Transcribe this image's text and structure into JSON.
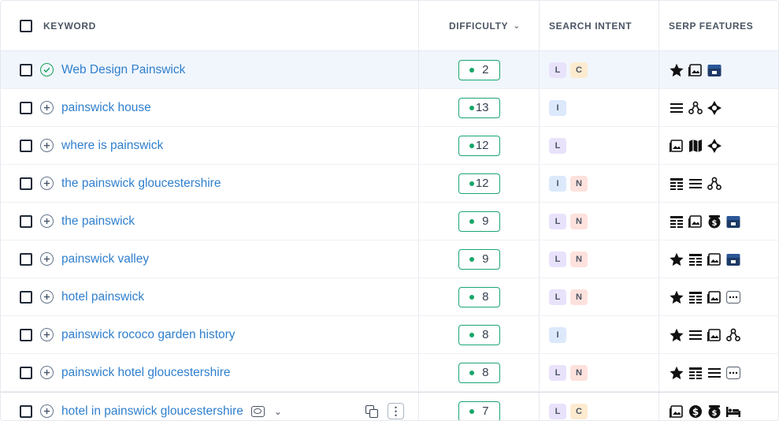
{
  "header": {
    "keyword": "KEYWORD",
    "difficulty": "DIFFICULTY",
    "intent": "SEARCH INTENT",
    "serp": "SERP FEATURES"
  },
  "rows": [
    {
      "keyword": "Web Design Painswick",
      "status": "added",
      "difficulty": "2",
      "intent": [
        "L",
        "C"
      ],
      "serp": [
        "star-icon",
        "image-icon",
        "local-pack-icon"
      ]
    },
    {
      "keyword": "painswick house",
      "status": "add",
      "difficulty": "13",
      "intent": [
        "I"
      ],
      "serp": [
        "list-icon",
        "sitelinks-icon",
        "knowledge-panel-icon"
      ]
    },
    {
      "keyword": "where is painswick",
      "status": "add",
      "difficulty": "12",
      "intent": [
        "L"
      ],
      "serp": [
        "image-icon",
        "map-icon",
        "knowledge-panel-icon"
      ]
    },
    {
      "keyword": "the painswick gloucestershire",
      "status": "add",
      "difficulty": "12",
      "intent": [
        "I",
        "N"
      ],
      "serp": [
        "table-icon",
        "list-icon",
        "sitelinks-icon"
      ]
    },
    {
      "keyword": "the painswick",
      "status": "add",
      "difficulty": "9",
      "intent": [
        "L",
        "N"
      ],
      "serp": [
        "table-icon",
        "image-icon",
        "ad-icon",
        "local-pack-icon"
      ]
    },
    {
      "keyword": "painswick valley",
      "status": "add",
      "difficulty": "9",
      "intent": [
        "L",
        "N"
      ],
      "serp": [
        "star-icon",
        "table-icon",
        "image-icon",
        "local-pack-icon"
      ]
    },
    {
      "keyword": "hotel painswick",
      "status": "add",
      "difficulty": "8",
      "intent": [
        "L",
        "N"
      ],
      "serp": [
        "star-icon",
        "table-icon",
        "image-icon",
        "more-icon"
      ]
    },
    {
      "keyword": "painswick rococo garden history",
      "status": "add",
      "difficulty": "8",
      "intent": [
        "I"
      ],
      "serp": [
        "star-icon",
        "list-icon",
        "image-icon",
        "sitelinks-icon"
      ]
    },
    {
      "keyword": "painswick hotel gloucestershire",
      "status": "add",
      "difficulty": "8",
      "intent": [
        "L",
        "N"
      ],
      "serp": [
        "star-icon",
        "table-icon",
        "list-icon",
        "more-icon"
      ]
    },
    {
      "keyword": "hotel in painswick gloucestershire",
      "status": "add",
      "difficulty": "7",
      "intent": [
        "L",
        "C"
      ],
      "serp": [
        "image-icon",
        "shopping-icon",
        "ad-icon",
        "hotel-icon"
      ]
    }
  ],
  "colors": {
    "link": "#2f7fcd",
    "difficulty_easy": "#1aa672",
    "added": "#19a05a",
    "selected_row": "#f1f6fd"
  }
}
